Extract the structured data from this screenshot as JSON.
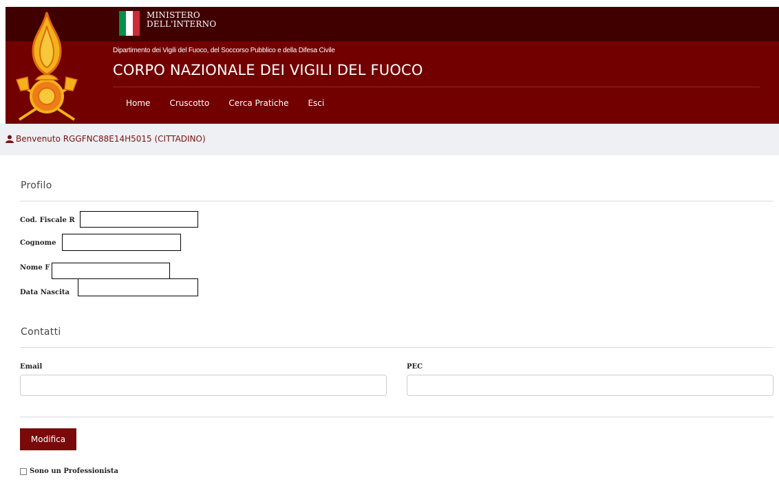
{
  "header": {
    "ministry_line1": "MINISTERO",
    "ministry_line2": "DELL'INTERNO",
    "department": "Dipartimento dei Vigili del Fuoco, del Soccorso Pubblico e della Difesa Civile",
    "title": "CORPO NAZIONALE DEI VIGILI DEL FUOCO",
    "emblem_icon": "fire-brigade-emblem-icon",
    "flag_icon": "italian-flag-icon",
    "colors": {
      "primary": "#720000",
      "top_bar": "#410000"
    }
  },
  "nav": {
    "items": [
      {
        "label": "Home"
      },
      {
        "label": "Cruscotto"
      },
      {
        "label": "Cerca Pratiche"
      },
      {
        "label": "Esci"
      }
    ]
  },
  "welcome": {
    "icon": "user-icon",
    "text": "Benvenuto RGGFNC88E14H5015 (CITTADINO)"
  },
  "profile": {
    "title": "Profilo",
    "fields": [
      {
        "label": "Cod. Fiscale R"
      },
      {
        "label": "Cognome"
      },
      {
        "label": "Nome F"
      },
      {
        "label": "Data Nascita"
      }
    ]
  },
  "contacts": {
    "title": "Contatti",
    "email_label": "Email",
    "email_value": "",
    "pec_label": "PEC",
    "pec_value": ""
  },
  "actions": {
    "modify_label": "Modifica",
    "professional_label": "Sono un Professionista",
    "professional_checked": false
  }
}
